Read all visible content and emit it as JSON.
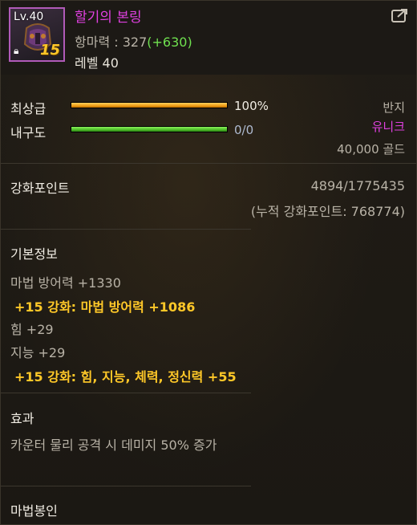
{
  "item": {
    "name": "할기의 본링",
    "icon_level": "Lv.40",
    "enhance_badge": "15",
    "resist_label": "항마력 : 327",
    "resist_bonus": "(+630)",
    "level": "레벨 40"
  },
  "grade": {
    "label": "최상급",
    "value_text": "100%",
    "value": 100,
    "color": "#f0a018"
  },
  "durability": {
    "label": "내구도",
    "value_text": "0/0",
    "value": 100,
    "color": "#4fc02a"
  },
  "meta": {
    "type": "반지",
    "rarity": "유니크",
    "rarity_color": "#e040e0",
    "price": "40,000 골드"
  },
  "reinforce": {
    "label": "강화포인트",
    "value": "4894/1775435",
    "cumulative": "(누적 강화포인트: 768774)"
  },
  "basic_info": {
    "title": "기본정보",
    "lines": [
      {
        "text": "마법 방어력 +1330",
        "type": "stat"
      },
      {
        "text": "+15 강화: 마법 방어력 +1086",
        "type": "enh"
      },
      {
        "text": "힘 +29",
        "type": "stat"
      },
      {
        "text": "지능 +29",
        "type": "stat"
      },
      {
        "text": "+15 강화: 힘, 지능, 체력, 정신력 +55",
        "type": "enh"
      }
    ]
  },
  "effect": {
    "title": "효과",
    "text": "카운터 물리 공격 시 데미지 50% 증가"
  },
  "seal": {
    "title": "마법봉인"
  },
  "icons": {
    "share": "share-icon",
    "lock": "lock-icon"
  }
}
